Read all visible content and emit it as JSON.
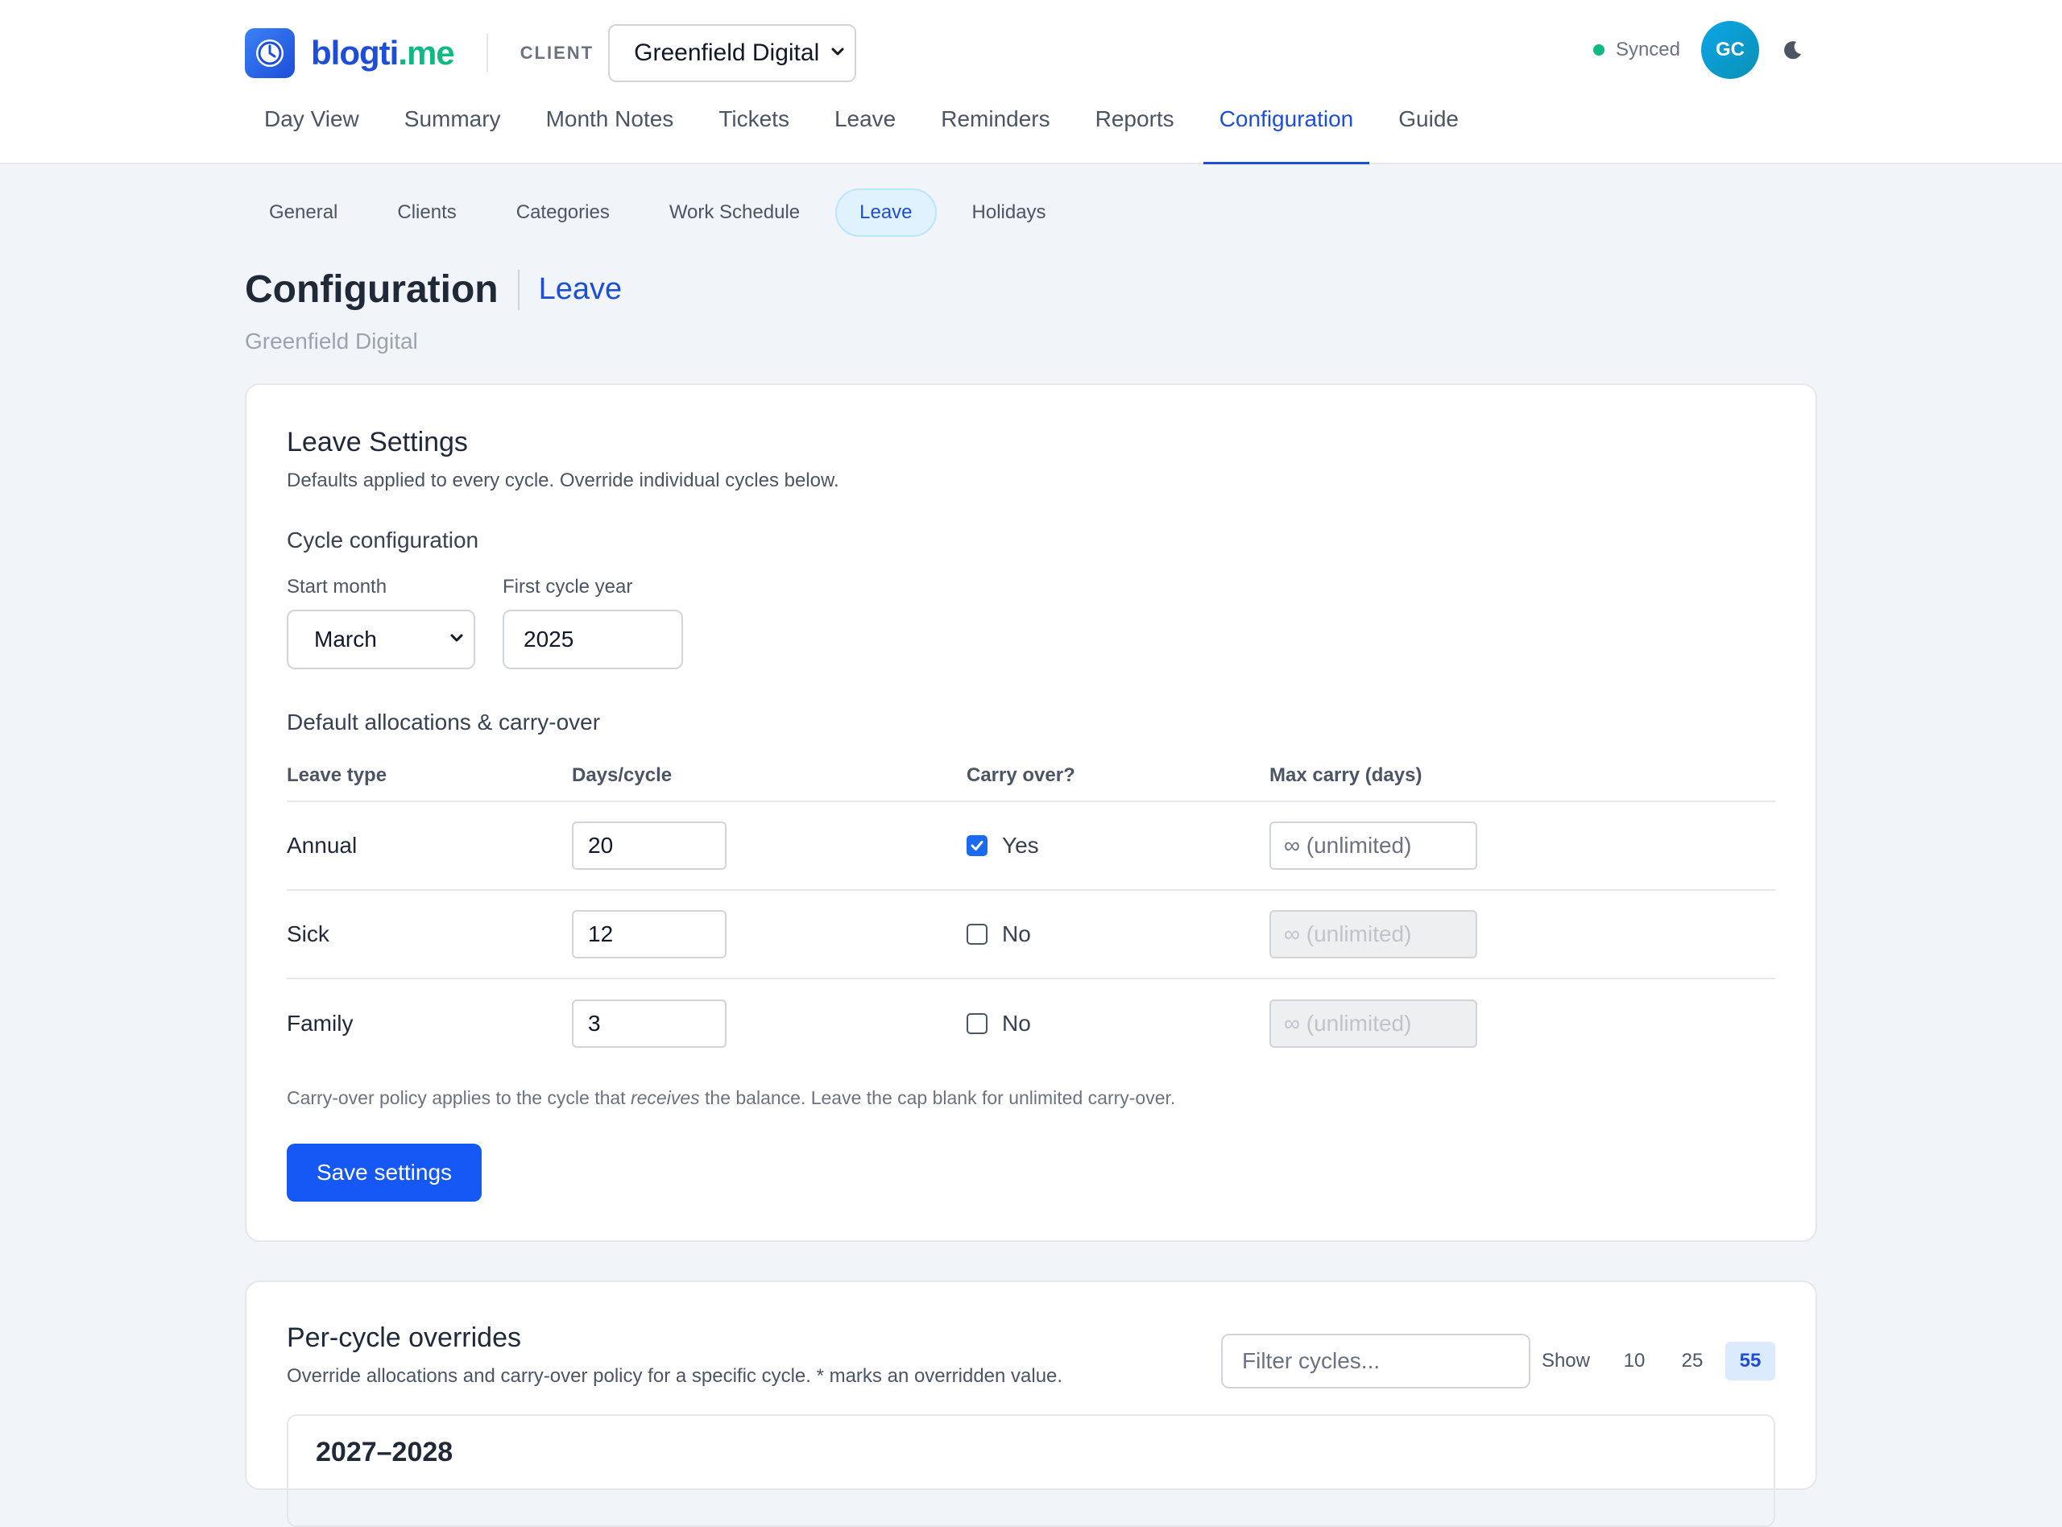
{
  "brand": {
    "name_part1": "blogti",
    "name_part2": ".me",
    "logo_icon": "clock-icon"
  },
  "header": {
    "client_label": "CLIENT",
    "client_selected": "Greenfield Digital",
    "sync_status": "Synced",
    "avatar_initials": "GC",
    "theme_toggle_icon": "moon-icon"
  },
  "nav": {
    "items": [
      "Day View",
      "Summary",
      "Month Notes",
      "Tickets",
      "Leave",
      "Reminders",
      "Reports",
      "Configuration",
      "Guide"
    ],
    "active": "Configuration"
  },
  "subnav": {
    "items": [
      "General",
      "Clients",
      "Categories",
      "Work Schedule",
      "Leave",
      "Holidays"
    ],
    "active": "Leave"
  },
  "page": {
    "title": "Configuration",
    "subtitle": "Leave",
    "client": "Greenfield Digital"
  },
  "leave_settings": {
    "title": "Leave Settings",
    "description": "Defaults applied to every cycle. Override individual cycles below.",
    "cycle_heading": "Cycle configuration",
    "start_month_label": "Start month",
    "start_month_value": "March",
    "first_year_label": "First cycle year",
    "first_year_value": "2025",
    "allocations_heading": "Default allocations & carry-over",
    "columns": [
      "Leave type",
      "Days/cycle",
      "Carry over?",
      "Max carry (days)"
    ],
    "rows": [
      {
        "type": "Annual",
        "days": "20",
        "carry": true,
        "carry_label": "Yes",
        "cap_placeholder": "∞ (unlimited)"
      },
      {
        "type": "Sick",
        "days": "12",
        "carry": false,
        "carry_label": "No",
        "cap_placeholder": "∞ (unlimited)"
      },
      {
        "type": "Family",
        "days": "3",
        "carry": false,
        "carry_label": "No",
        "cap_placeholder": "∞ (unlimited)"
      }
    ],
    "note_before": "Carry-over policy applies to the cycle that ",
    "note_em": "receives",
    "note_after": " the balance. Leave the cap blank for unlimited carry-over.",
    "save_label": "Save settings"
  },
  "overrides": {
    "title": "Per-cycle overrides",
    "description": "Override allocations and carry-over policy for a specific cycle. * marks an overridden value.",
    "filter_placeholder": "Filter cycles...",
    "show_label": "Show",
    "show_options": [
      "10",
      "25",
      "55"
    ],
    "show_active": "55",
    "first_cycle_title": "2027–2028"
  },
  "colors": {
    "accent": "#1d4ed8",
    "primary_button": "#1558f5",
    "brand_green": "#10b981",
    "synced": "#10b981"
  }
}
